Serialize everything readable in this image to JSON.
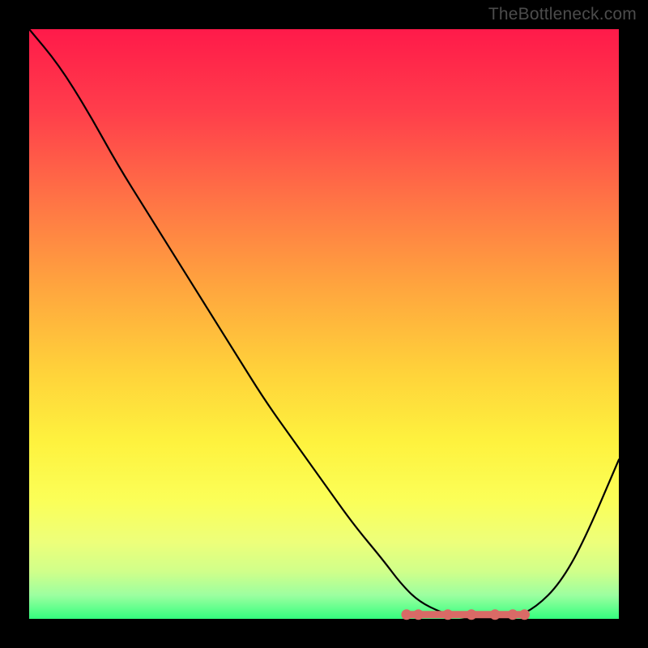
{
  "attribution": "TheBottleneck.com",
  "chart_data": {
    "type": "line",
    "title": "",
    "xlabel": "",
    "ylabel": "",
    "xlim": [
      0,
      100
    ],
    "ylim": [
      0,
      100
    ],
    "series": [
      {
        "name": "bottleneck-curve",
        "x": [
          0,
          5,
          10,
          15,
          20,
          25,
          30,
          35,
          40,
          45,
          50,
          55,
          60,
          63,
          66,
          70,
          74,
          78,
          82,
          86,
          90,
          94,
          100
        ],
        "y": [
          100,
          94,
          86,
          77,
          69,
          61,
          53,
          45,
          37,
          30,
          23,
          16,
          10,
          6,
          3,
          1,
          0,
          0,
          0,
          2,
          6,
          13,
          27
        ]
      }
    ],
    "highlight": {
      "range_x": [
        64,
        84
      ],
      "dots_x": [
        64,
        66,
        71,
        75,
        79,
        82,
        84
      ],
      "y": 1
    },
    "gradient_note": "background encodes bottleneck severity: red=high, green=low"
  }
}
